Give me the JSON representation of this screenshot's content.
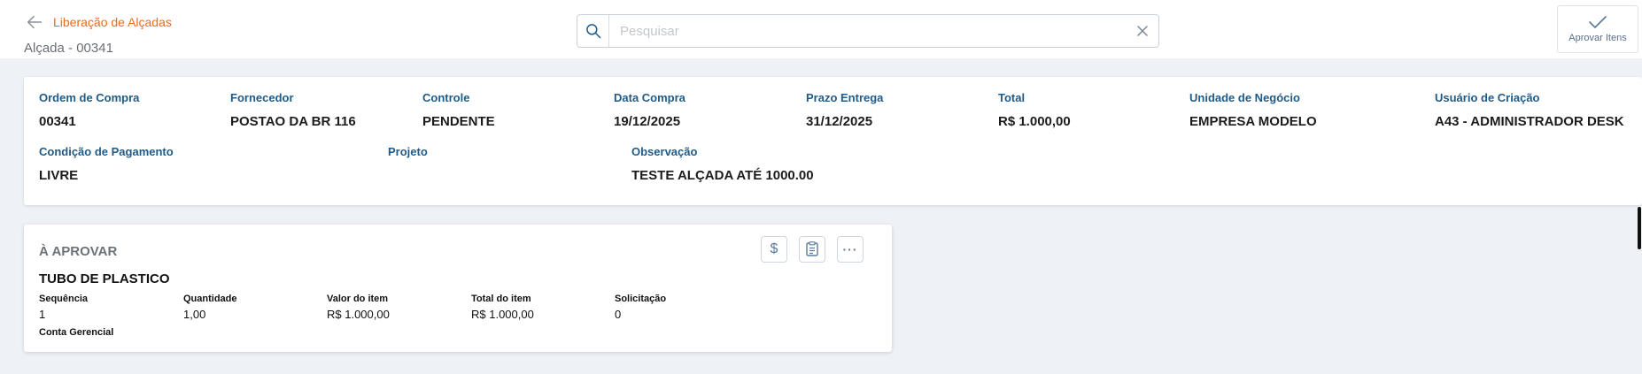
{
  "header": {
    "back_label": "Liberação de Alçadas",
    "subtitle": "Alçada - 00341",
    "search_placeholder": "Pesquisar",
    "approve_label": "Aprovar Itens"
  },
  "order": {
    "row1": [
      {
        "label": "Ordem de Compra",
        "value": "00341"
      },
      {
        "label": "Fornecedor",
        "value": "POSTAO DA BR 116"
      },
      {
        "label": "Controle",
        "value": "PENDENTE"
      },
      {
        "label": "Data Compra",
        "value": "19/12/2025"
      },
      {
        "label": "Prazo Entrega",
        "value": "31/12/2025"
      },
      {
        "label": "Total",
        "value": "R$ 1.000,00"
      },
      {
        "label": "Unidade de Negócio",
        "value": "EMPRESA MODELO"
      },
      {
        "label": "Usuário de Criação",
        "value": "A43 - ADMINISTRADOR DESK"
      }
    ],
    "row2": [
      {
        "label": "Condição de Pagamento",
        "value": "LIVRE"
      },
      {
        "label": "Projeto",
        "value": ""
      },
      {
        "label": "Observação",
        "value": "TESTE ALÇADA ATÉ 1000.00"
      }
    ]
  },
  "item": {
    "status": "À APROVAR",
    "name": "TUBO DE PLASTICO",
    "columns": [
      {
        "label": "Sequência",
        "value": "1"
      },
      {
        "label": "Quantidade",
        "value": "1,00"
      },
      {
        "label": "Valor do item",
        "value": "R$ 1.000,00"
      },
      {
        "label": "Total do item",
        "value": "R$ 1.000,00"
      },
      {
        "label": "Solicitação",
        "value": "0"
      }
    ],
    "extra_label": "Conta Gerencial",
    "currency_symbol": "$",
    "more_symbol": "···"
  },
  "colors": {
    "accent": "#ea6a1f",
    "label": "#1f5b88",
    "icon": "#5b7a99"
  }
}
